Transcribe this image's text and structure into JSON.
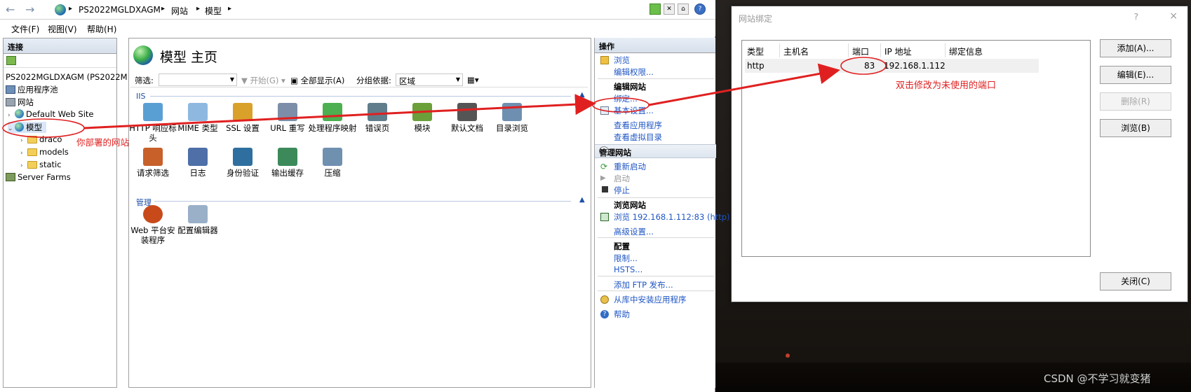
{
  "address": {
    "crumbs": [
      "PS2022MGLDXAGM",
      "网站",
      "模型"
    ]
  },
  "menu": [
    "文件(F)",
    "视图(V)",
    "帮助(H)"
  ],
  "connections": {
    "header": "连接",
    "tree": [
      {
        "label": "PS2022MGLDXAGM (PS2022M",
        "icon": "server-icon"
      },
      {
        "label": "应用程序池",
        "icon": "app-pool-icon"
      },
      {
        "label": "网站",
        "icon": "sites-folder-icon"
      },
      {
        "label": "Default Web Site",
        "icon": "globe-icon"
      },
      {
        "label": "模型",
        "icon": "globe-icon"
      },
      {
        "label": "draco",
        "icon": "folder-icon"
      },
      {
        "label": "models",
        "icon": "folder-icon"
      },
      {
        "label": "static",
        "icon": "folder-icon"
      },
      {
        "label": "Server Farms",
        "icon": "server-farms-icon"
      }
    ]
  },
  "main": {
    "title": "模型 主页",
    "filter": {
      "label": "筛选:",
      "start": "开始(G)",
      "show_all": "全部显示(A)",
      "group_label": "分组依据:",
      "group_value": "区域"
    },
    "sections": {
      "iis": "IIS",
      "manage": "管理"
    },
    "iis_features": [
      "HTTP 响应标头",
      "MIME 类型",
      "SSL 设置",
      "URL 重写",
      "处理程序映射",
      "错误页",
      "模块",
      "默认文档",
      "目录浏览",
      "请求筛选",
      "日志",
      "身份验证",
      "输出缓存",
      "压缩"
    ],
    "manage_features": [
      "Web 平台安装程序",
      "配置编辑器"
    ]
  },
  "actions": {
    "header": "操作",
    "browse": "浏览",
    "edit_permissions": "编辑权限...",
    "edit_site_header": "编辑网站",
    "bindings": "绑定...",
    "basic_settings": "基本设置...",
    "view_apps": "查看应用程序",
    "view_vdirs": "查看虚拟目录",
    "manage_site_header": "管理网站",
    "restart": "重新启动",
    "start": "启动",
    "stop": "停止",
    "browse_site_header": "浏览网站",
    "browse_url": "浏览 192.168.1.112:83 (http)",
    "advanced_settings": "高级设置...",
    "config_header": "配置",
    "limits": "限制...",
    "hsts": "HSTS...",
    "add_ftp": "添加 FTP 发布...",
    "install_gallery": "从库中安装应用程序",
    "help": "帮助"
  },
  "dialog": {
    "title": "网站绑定",
    "question": "?",
    "close_x": "×",
    "columns": [
      "类型",
      "主机名",
      "端口",
      "IP 地址",
      "绑定信息"
    ],
    "rows": [
      {
        "type": "http",
        "host": "",
        "port": "83",
        "ip": "192.168.1.112",
        "info": ""
      }
    ],
    "buttons": {
      "add": "添加(A)...",
      "edit": "编辑(E)...",
      "remove": "删除(R)",
      "browse": "浏览(B)",
      "close": "关闭(C)"
    }
  },
  "annotations": {
    "site_note": "你部署的网站",
    "port_note": "双击修改为未使用的端口",
    "annotation_color": "#e02020"
  },
  "watermark": "CSDN @不学习就变猪"
}
